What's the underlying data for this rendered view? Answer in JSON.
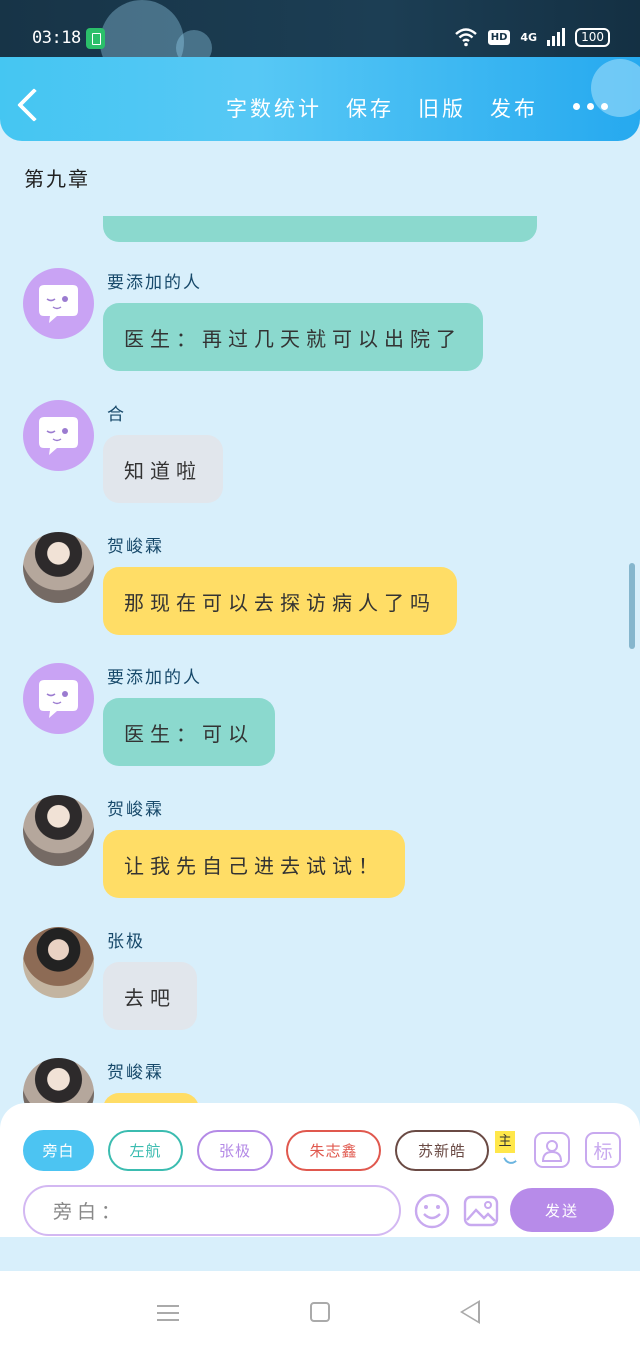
{
  "status_bar": {
    "time": "03:18",
    "hd": "HD",
    "network": "4G",
    "battery": "100"
  },
  "header": {
    "menu": [
      {
        "label": "字数统计"
      },
      {
        "label": "保存"
      },
      {
        "label": "旧版"
      },
      {
        "label": "发布"
      }
    ]
  },
  "chapter_title": "第九章",
  "messages": [
    {
      "sender": "要添加的人",
      "text": "医生：再过几天就可以出院了",
      "bubble_color": "#8bd9ce",
      "avatar": "bot-avatar"
    },
    {
      "sender": "合",
      "text": "知道啦",
      "bubble_color": "#e1e6ec",
      "avatar": "bot-avatar"
    },
    {
      "sender": "贺峻霖",
      "text": "那现在可以去探访病人了吗",
      "bubble_color": "#ffdd66",
      "avatar": "photo-avatar"
    },
    {
      "sender": "要添加的人",
      "text": "医生：可以",
      "bubble_color": "#8bd9ce",
      "avatar": "bot-avatar"
    },
    {
      "sender": "贺峻霖",
      "text": "让我先自己进去试试！",
      "bubble_color": "#ffdd66",
      "avatar": "photo-avatar"
    },
    {
      "sender": "张极",
      "text": "去吧",
      "bubble_color": "#e1e6ec",
      "avatar": "photo-avatar"
    },
    {
      "sender": "贺峻霖",
      "text": "",
      "bubble_color": "#ffdd66",
      "avatar": "photo-avatar"
    }
  ],
  "roles": [
    {
      "label": "旁白",
      "color": "#4cc4f2",
      "active": true
    },
    {
      "label": "左航",
      "color": "#3bbcb0"
    },
    {
      "label": "张极",
      "color": "#b48ae6"
    },
    {
      "label": "朱志鑫",
      "color": "#e0584e"
    },
    {
      "label": "苏新皓",
      "color": "#6a4a44"
    }
  ],
  "tag_icon_text": "主",
  "mark_label": "标",
  "input": {
    "placeholder": "旁白："
  },
  "send_label": "发送"
}
